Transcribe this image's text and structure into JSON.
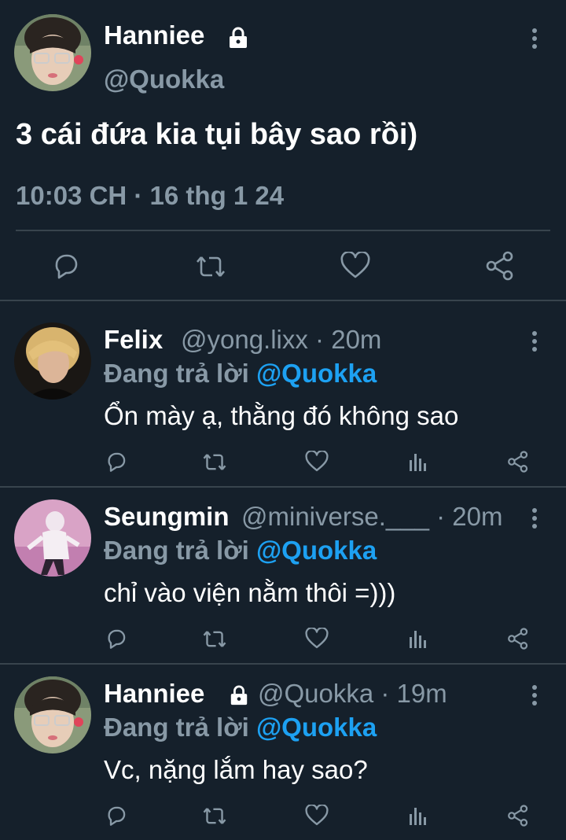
{
  "main_tweet": {
    "name": "Hanniee",
    "handle": "@Quokka",
    "text": "3 cái đứa kia tụi bây sao rồi)",
    "time": "10:03 CH · 16 thg 1 24"
  },
  "replies": [
    {
      "name": "Felix",
      "handle_time": "@yong.lixx · 20m",
      "replying_prefix": "Đang trả lời",
      "mention": "@Quokka",
      "text": "Ổn mày ạ, thằng đó không sao"
    },
    {
      "name": "Seungmin",
      "handle_time": "@miniverse.___ · 20m",
      "replying_prefix": "Đang trả lời",
      "mention": "@Quokka",
      "text": "chỉ vào viện nằm thôi =)))"
    },
    {
      "name": "Hanniee",
      "handle_time": "@Quokka · 19m",
      "replying_prefix": "Đang trả lời",
      "mention": "@Quokka",
      "text": "Vc, nặng lắm hay sao?"
    }
  ],
  "icons": [
    "lock-icon",
    "more-icon",
    "reply-icon",
    "retweet-icon",
    "like-icon",
    "share-icon",
    "analytics-icon"
  ],
  "colors": {
    "background": "#15202b",
    "secondary_text": "#8899a6",
    "mention": "#1da1f2",
    "divider": "#38444d"
  }
}
